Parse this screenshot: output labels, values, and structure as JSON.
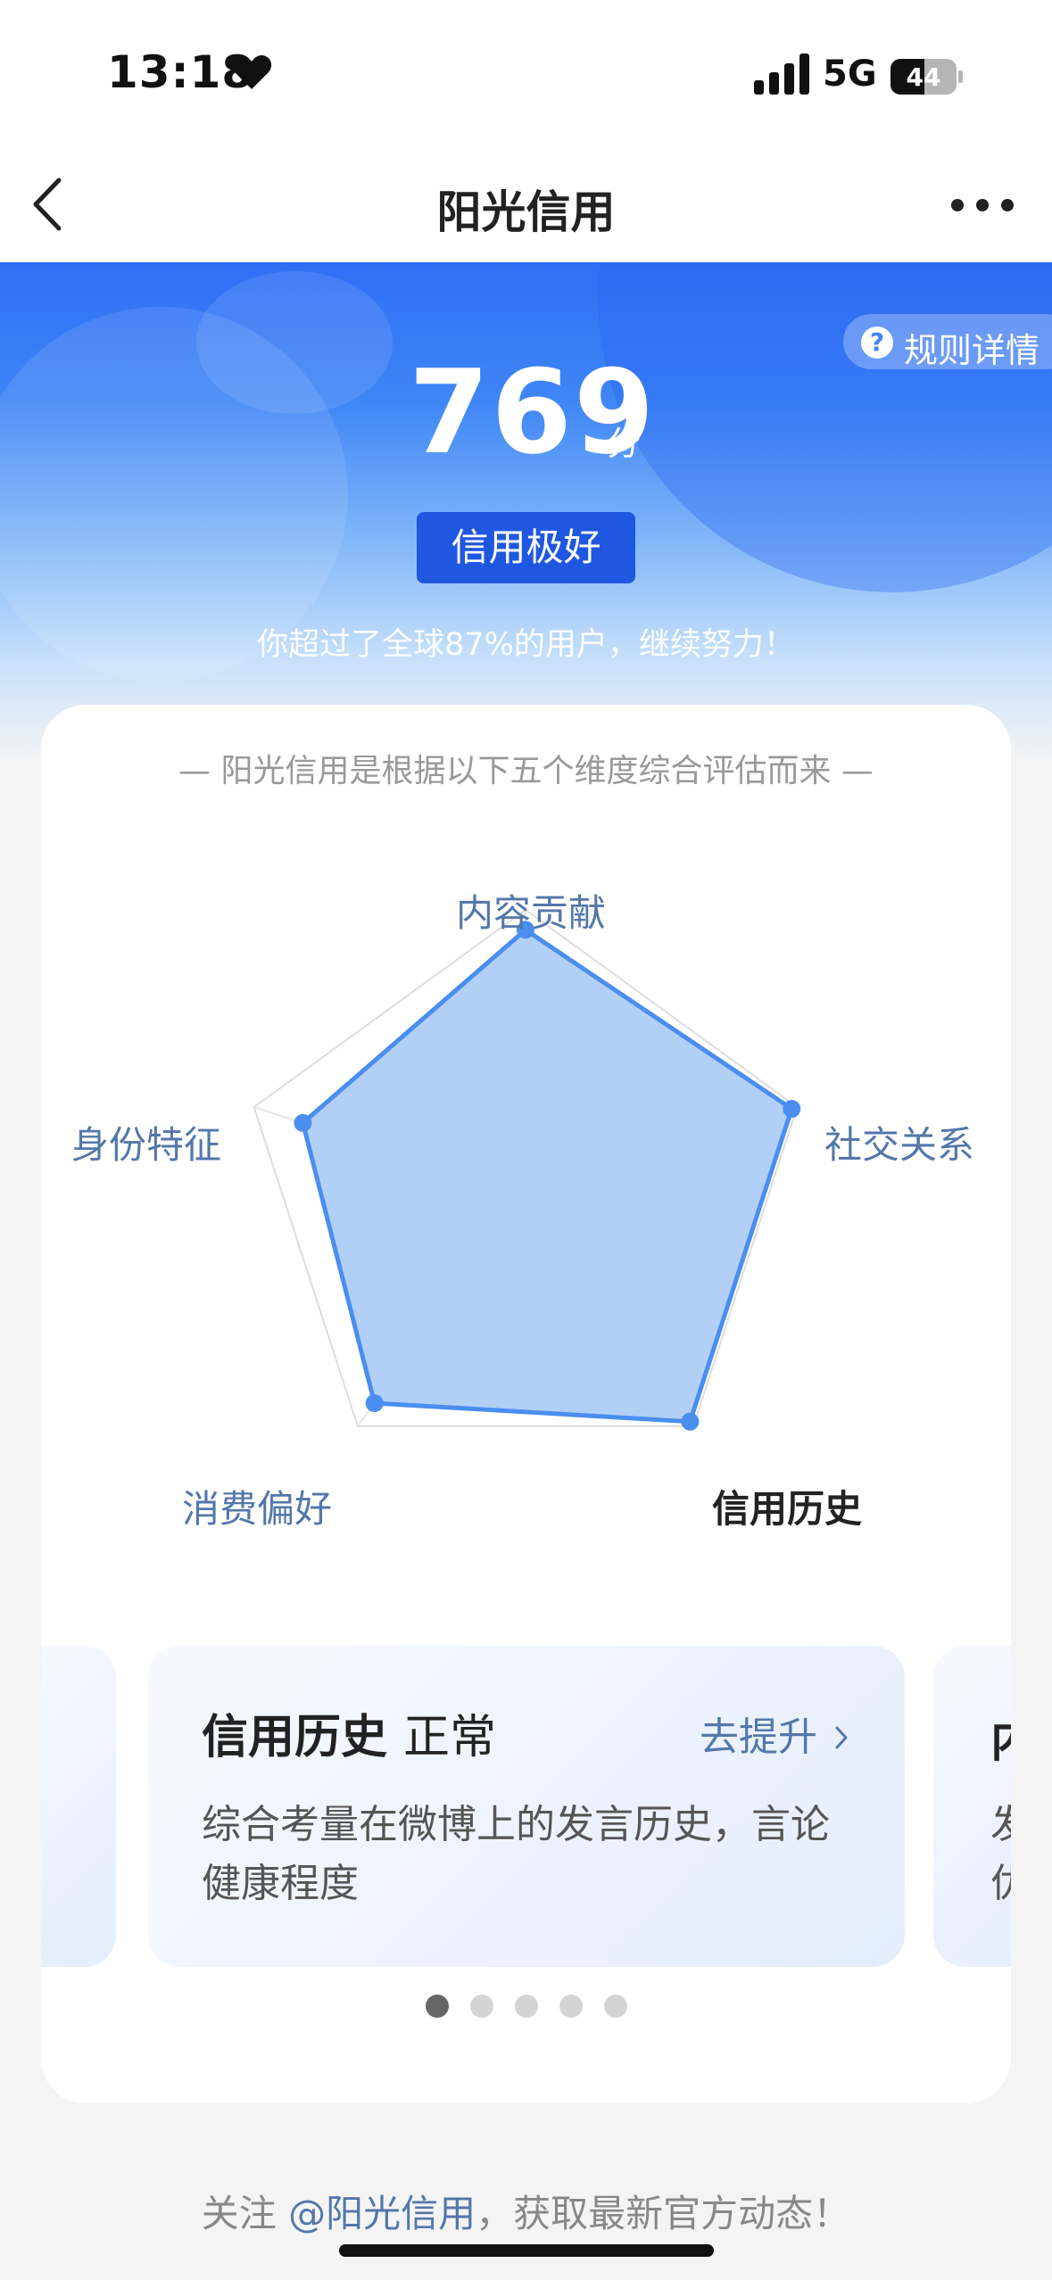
{
  "status_bar": {
    "time": "13:18",
    "network": "5G",
    "battery": "44",
    "icons": [
      "heart-icon",
      "signal-icon",
      "battery-icon"
    ]
  },
  "nav": {
    "title": "阳光信用",
    "back_icon": "chevron-left-icon",
    "more_icon": "more-horizontal-icon"
  },
  "hero": {
    "rules_label": "规则详情",
    "rules_icon": "question-icon",
    "score": "769",
    "score_unit": "分",
    "level": "信用极好",
    "beat_text": "你超过了全球87%的用户，继续努力！"
  },
  "card": {
    "header": "— 阳光信用是根据以下五个维度综合评估而来 —",
    "dimensions": [
      {
        "label": "内容贡献",
        "value": 0.93,
        "active": false
      },
      {
        "label": "社交关系",
        "value": 0.98,
        "active": false
      },
      {
        "label": "信用历史",
        "value": 0.98,
        "active": true
      },
      {
        "label": "消费偏好",
        "value": 0.9,
        "active": false
      },
      {
        "label": "身份特征",
        "value": 0.82,
        "active": false
      }
    ],
    "slide": {
      "title": "信用历史",
      "status": "正常",
      "link": "去提升",
      "link_icon": "chevron-right-icon",
      "description": "综合考量在微博上的发言历史，言论健康程度"
    },
    "next_peek": {
      "title_fragment": "内",
      "desc_fragments": [
        "发",
        "优"
      ]
    },
    "page_count": 5,
    "active_page": 1
  },
  "footer": {
    "prefix": "关注 ",
    "handle": "@阳光信用",
    "suffix": "，获取最新官方动态！"
  },
  "colors": {
    "primary_blue": "#2f6ef4",
    "badge_blue": "#1f57e0",
    "radar_stroke": "#4a8ef0",
    "radar_fill": "#aecdf6",
    "label_blue": "#5377aa"
  }
}
